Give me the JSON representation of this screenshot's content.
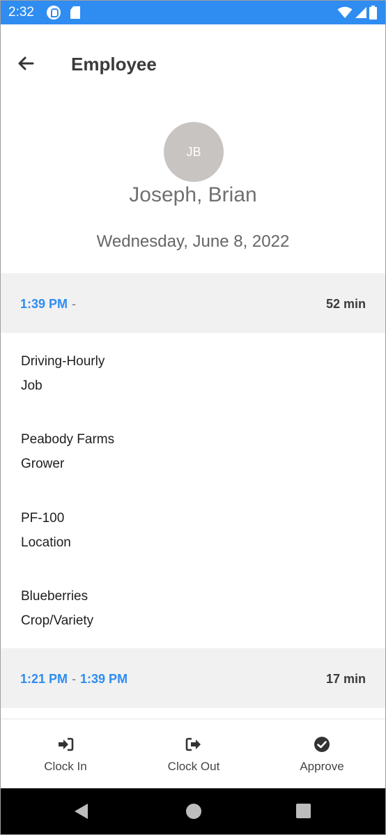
{
  "status_bar": {
    "time": "2:32",
    "icons": [
      "app-notification-icon",
      "sd-card-icon",
      "wifi-icon",
      "cellular-signal-icon",
      "battery-icon"
    ],
    "color": "#2f8cf0"
  },
  "header": {
    "back_icon": "arrow-left-icon",
    "title": "Employee"
  },
  "employee": {
    "initials": "JB",
    "name": "Joseph, Brian",
    "date": "Wednesday, June 8, 2022"
  },
  "entries": [
    {
      "start": "1:39 PM",
      "separator": "-",
      "end": "",
      "duration": "52 min",
      "details": [
        {
          "value": "Driving-Hourly",
          "label": "Job"
        },
        {
          "value": "Peabody Farms",
          "label": "Grower"
        },
        {
          "value": "PF-100",
          "label": "Location"
        },
        {
          "value": "Blueberries",
          "label": "Crop/Variety"
        }
      ]
    },
    {
      "start": "1:21 PM",
      "separator": "-",
      "end": "1:39 PM",
      "duration": "17 min"
    }
  ],
  "bottom_nav": {
    "items": [
      {
        "label": "Clock In",
        "icon": "sign-in-icon"
      },
      {
        "label": "Clock Out",
        "icon": "sign-out-icon"
      },
      {
        "label": "Approve",
        "icon": "check-circle-icon"
      }
    ]
  },
  "colors": {
    "accent": "#2f8cf0",
    "row_background": "#f1f1f1",
    "avatar_background": "#c8c4c2"
  }
}
